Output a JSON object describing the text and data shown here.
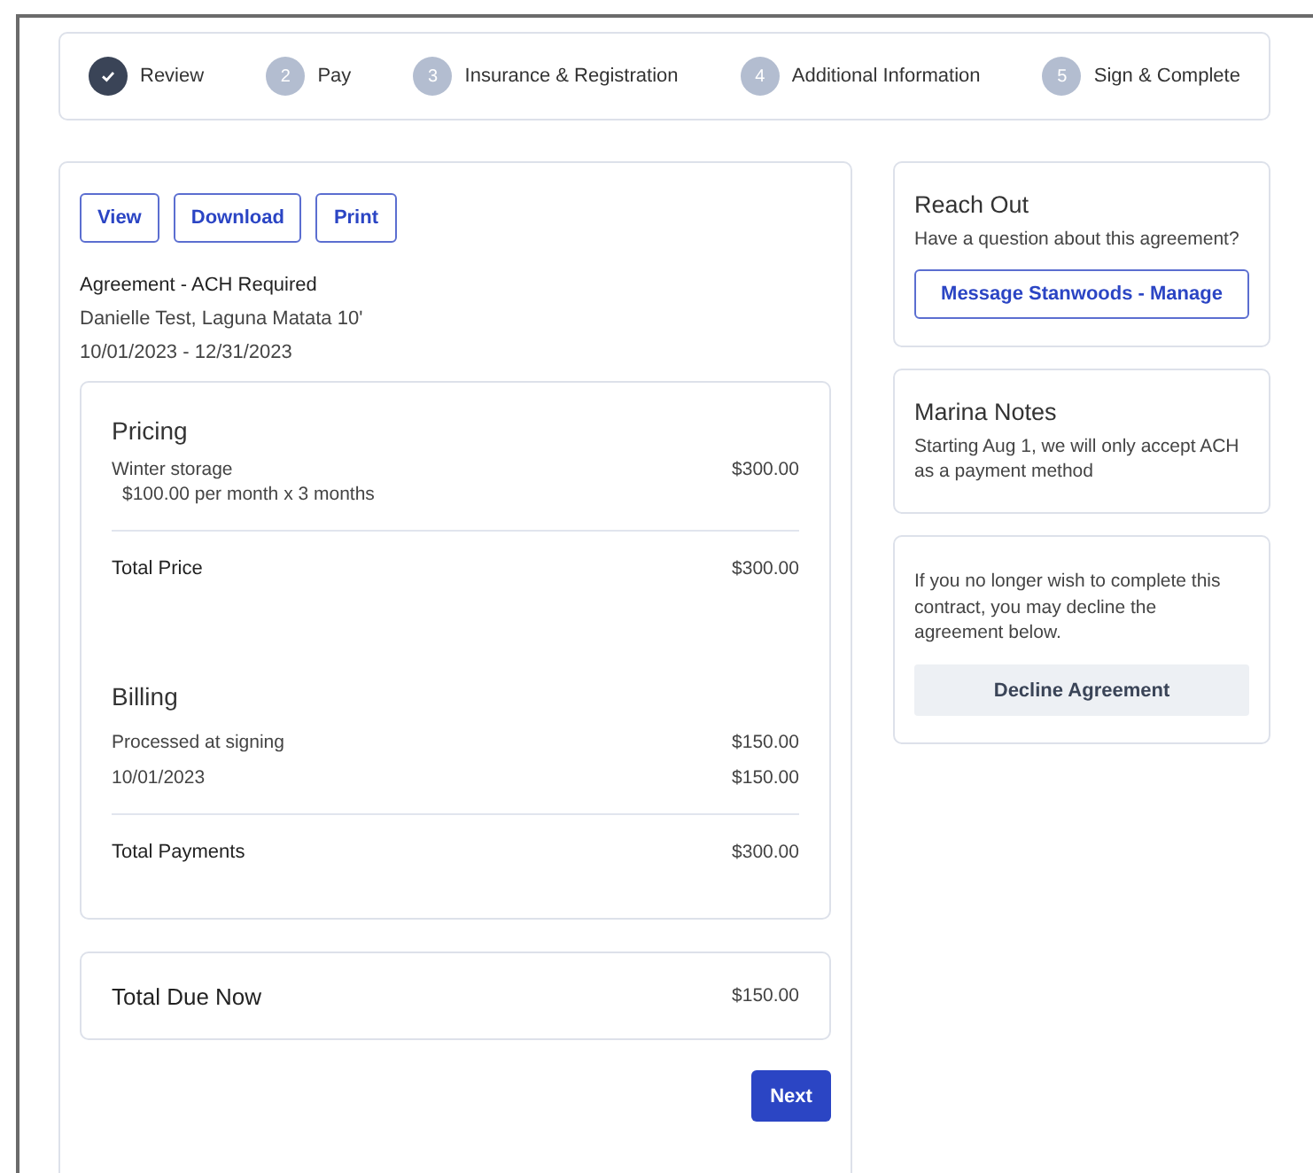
{
  "steps": [
    {
      "label": "Review",
      "done": true
    },
    {
      "number": "2",
      "label": "Pay",
      "done": false
    },
    {
      "number": "3",
      "label": "Insurance & Registration",
      "done": false
    },
    {
      "number": "4",
      "label": "Additional Information",
      "done": false
    },
    {
      "number": "5",
      "label": "Sign & Complete",
      "done": false
    }
  ],
  "document_buttons": [
    "View",
    "Download",
    "Print"
  ],
  "agreement": {
    "title": "Agreement - ACH Required",
    "customer": "Danielle Test, Laguna Matata 10'",
    "dates": "10/01/2023 - 12/31/2023"
  },
  "pricing": {
    "heading": "Pricing",
    "items": [
      {
        "name": "Winter storage",
        "detail": "$100.00 per month x 3 months",
        "amount": "$300.00"
      }
    ],
    "total_label": "Total Price",
    "total": "$300.00"
  },
  "billing": {
    "heading": "Billing",
    "items": [
      {
        "name": "Processed at signing",
        "amount": "$150.00"
      },
      {
        "name": "10/01/2023",
        "amount": "$150.00"
      }
    ],
    "total_label": "Total Payments",
    "total": "$300.00"
  },
  "total_due": {
    "label": "Total Due Now",
    "amount": "$150.00"
  },
  "next_button": "Next",
  "reach_out": {
    "heading": "Reach Out",
    "text": "Have a question about this agreement?",
    "button": "Message Stanwoods - Manage"
  },
  "marina_notes": {
    "heading": "Marina Notes",
    "text": "Starting Aug 1, we will only accept ACH as a payment method"
  },
  "decline": {
    "text": "If you no longer wish to complete this contract, you may decline the agreement below.",
    "button": "Decline Agreement"
  }
}
